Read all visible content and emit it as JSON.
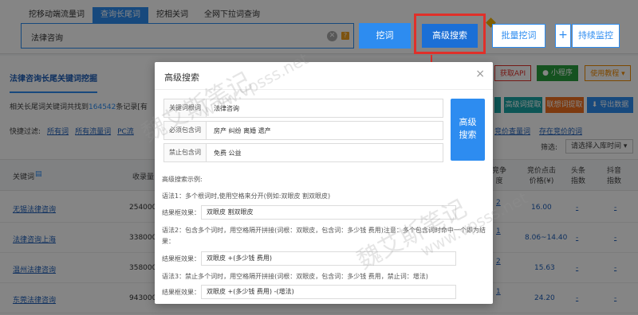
{
  "tabs": [
    "挖移动端流量词",
    "查询长尾词",
    "挖相关词",
    "全网下拉词查询"
  ],
  "search": {
    "value": "法律咨询"
  },
  "buttons": {
    "dig": "挖词",
    "advanced": "高级搜索",
    "batch": "批量挖词",
    "plus": "+",
    "monitor": "持续监控"
  },
  "main": {
    "title": "法律咨询长尾关键词挖掘",
    "summary_prefix": "相关长尾词关键词共找到",
    "summary_count": "164542",
    "summary_suffix": "条记录[有",
    "get_api": "获取API",
    "miniapp": "小程序",
    "tutorial": "使用教程 ▾",
    "tool_btn1": "高级词提取",
    "tool_btn2": "联想词提取",
    "export": "导出数据",
    "filter_label": "快捷过滤:",
    "filter_items": [
      "所有词",
      "所有流量词",
      "PC流"
    ],
    "right_link1": "竞价查量词",
    "right_link2": "存在竞价的词",
    "sort_label": "筛选:",
    "sort_select": "请选择入库时间",
    "headers": {
      "keyword": "关键词",
      "volume": "收录量",
      "competition": "竞争\n度",
      "cpc": "竞价点击\n价格(¥)",
      "toutiao": "头条\n指数",
      "douyin": "抖音\n指数"
    },
    "rows": [
      {
        "keyword": "无锡法律咨询",
        "volume": "2540000",
        "comp": "2",
        "cpc": "16.00",
        "toutiao": "-",
        "douyin": "-"
      },
      {
        "keyword": "法律咨询上海",
        "volume": "3380000",
        "comp": "1",
        "cpc": "8.06~14.40",
        "toutiao": "-",
        "douyin": "-"
      },
      {
        "keyword": "温州法律咨询",
        "volume": "3580000",
        "comp": "2",
        "cpc": "15.63",
        "toutiao": "-",
        "douyin": "-"
      },
      {
        "keyword": "东莞法律咨询",
        "volume": "9430000",
        "comp": "1",
        "cpc": "24.20",
        "toutiao": "-",
        "douyin": "-"
      }
    ]
  },
  "modal": {
    "title": "高级搜索",
    "close": "×",
    "fields": [
      {
        "label": "关键词根词",
        "value": "法律咨询"
      },
      {
        "label": "必须包含词",
        "value": "房产 纠纷 离婚 遗产"
      },
      {
        "label": "禁止包含词",
        "value": "免费 公益"
      }
    ],
    "search_btn_line1": "高级",
    "search_btn_line2": "搜索",
    "example_title": "高级搜索示例:",
    "ex1": "语法1：多个根词时,使用空格来分开(例如:双眼皮 割双眼皮)",
    "ex1_result": "双眼皮 割双眼皮",
    "ex2": "语法2：包含多个词时，用空格隔开拼接(词根：双眼皮，包含词：多少钱 费用)注意：多个包含词时命中一个即为结果：",
    "ex2_result": "双眼皮 +(多少钱 费用)",
    "ex3": "语法3：禁止多个词时，用空格隔开拼接(词根：双眼皮，包含词：多少钱 费用，禁止词：增法)",
    "ex3_result": "双眼皮 +(多少钱 费用) -(增法)",
    "result_label": "结果框效果："
  },
  "watermark": [
    "魏艾斯笔记",
    "www.vpsss.net"
  ],
  "colors": {
    "primary": "#2d8cf0",
    "highlight": "#e0302a"
  }
}
